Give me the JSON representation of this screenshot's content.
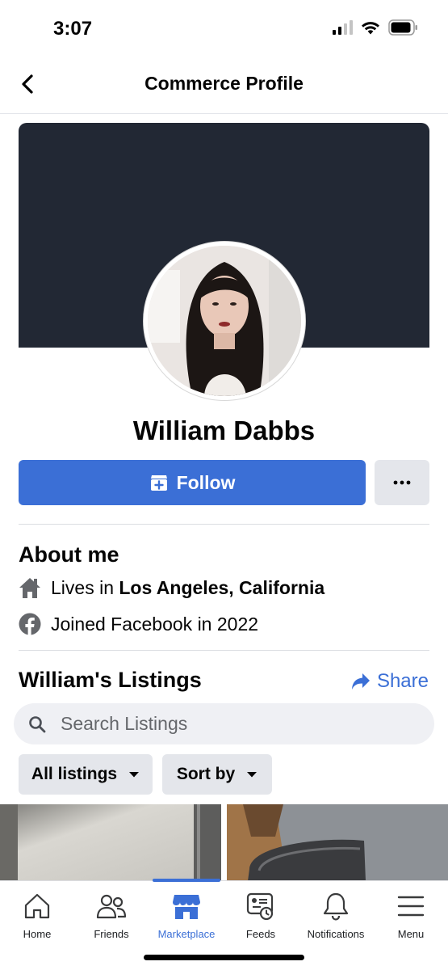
{
  "status_bar": {
    "time": "3:07"
  },
  "header": {
    "title": "Commerce Profile"
  },
  "profile": {
    "name": "William Dabbs",
    "follow_label": "Follow",
    "more_label": "•••"
  },
  "about": {
    "title": "About me",
    "lives_prefix": "Lives in ",
    "lives_location": "Los Angeles, California",
    "joined": "Joined Facebook in 2022"
  },
  "listings": {
    "title": "William's Listings",
    "share_label": "Share",
    "search_placeholder": "Search Listings",
    "filter_all": "All listings",
    "filter_sort": "Sort by"
  },
  "tabs": [
    {
      "label": "Home",
      "icon": "home-icon"
    },
    {
      "label": "Friends",
      "icon": "friends-icon"
    },
    {
      "label": "Marketplace",
      "icon": "marketplace-icon",
      "active": true
    },
    {
      "label": "Feeds",
      "icon": "feeds-icon"
    },
    {
      "label": "Notifications",
      "icon": "bell-icon"
    },
    {
      "label": "Menu",
      "icon": "menu-icon"
    }
  ],
  "colors": {
    "accent": "#3b6fd6",
    "cover": "#222834",
    "chip_bg": "#e4e6eb",
    "search_bg": "#eff0f4"
  }
}
